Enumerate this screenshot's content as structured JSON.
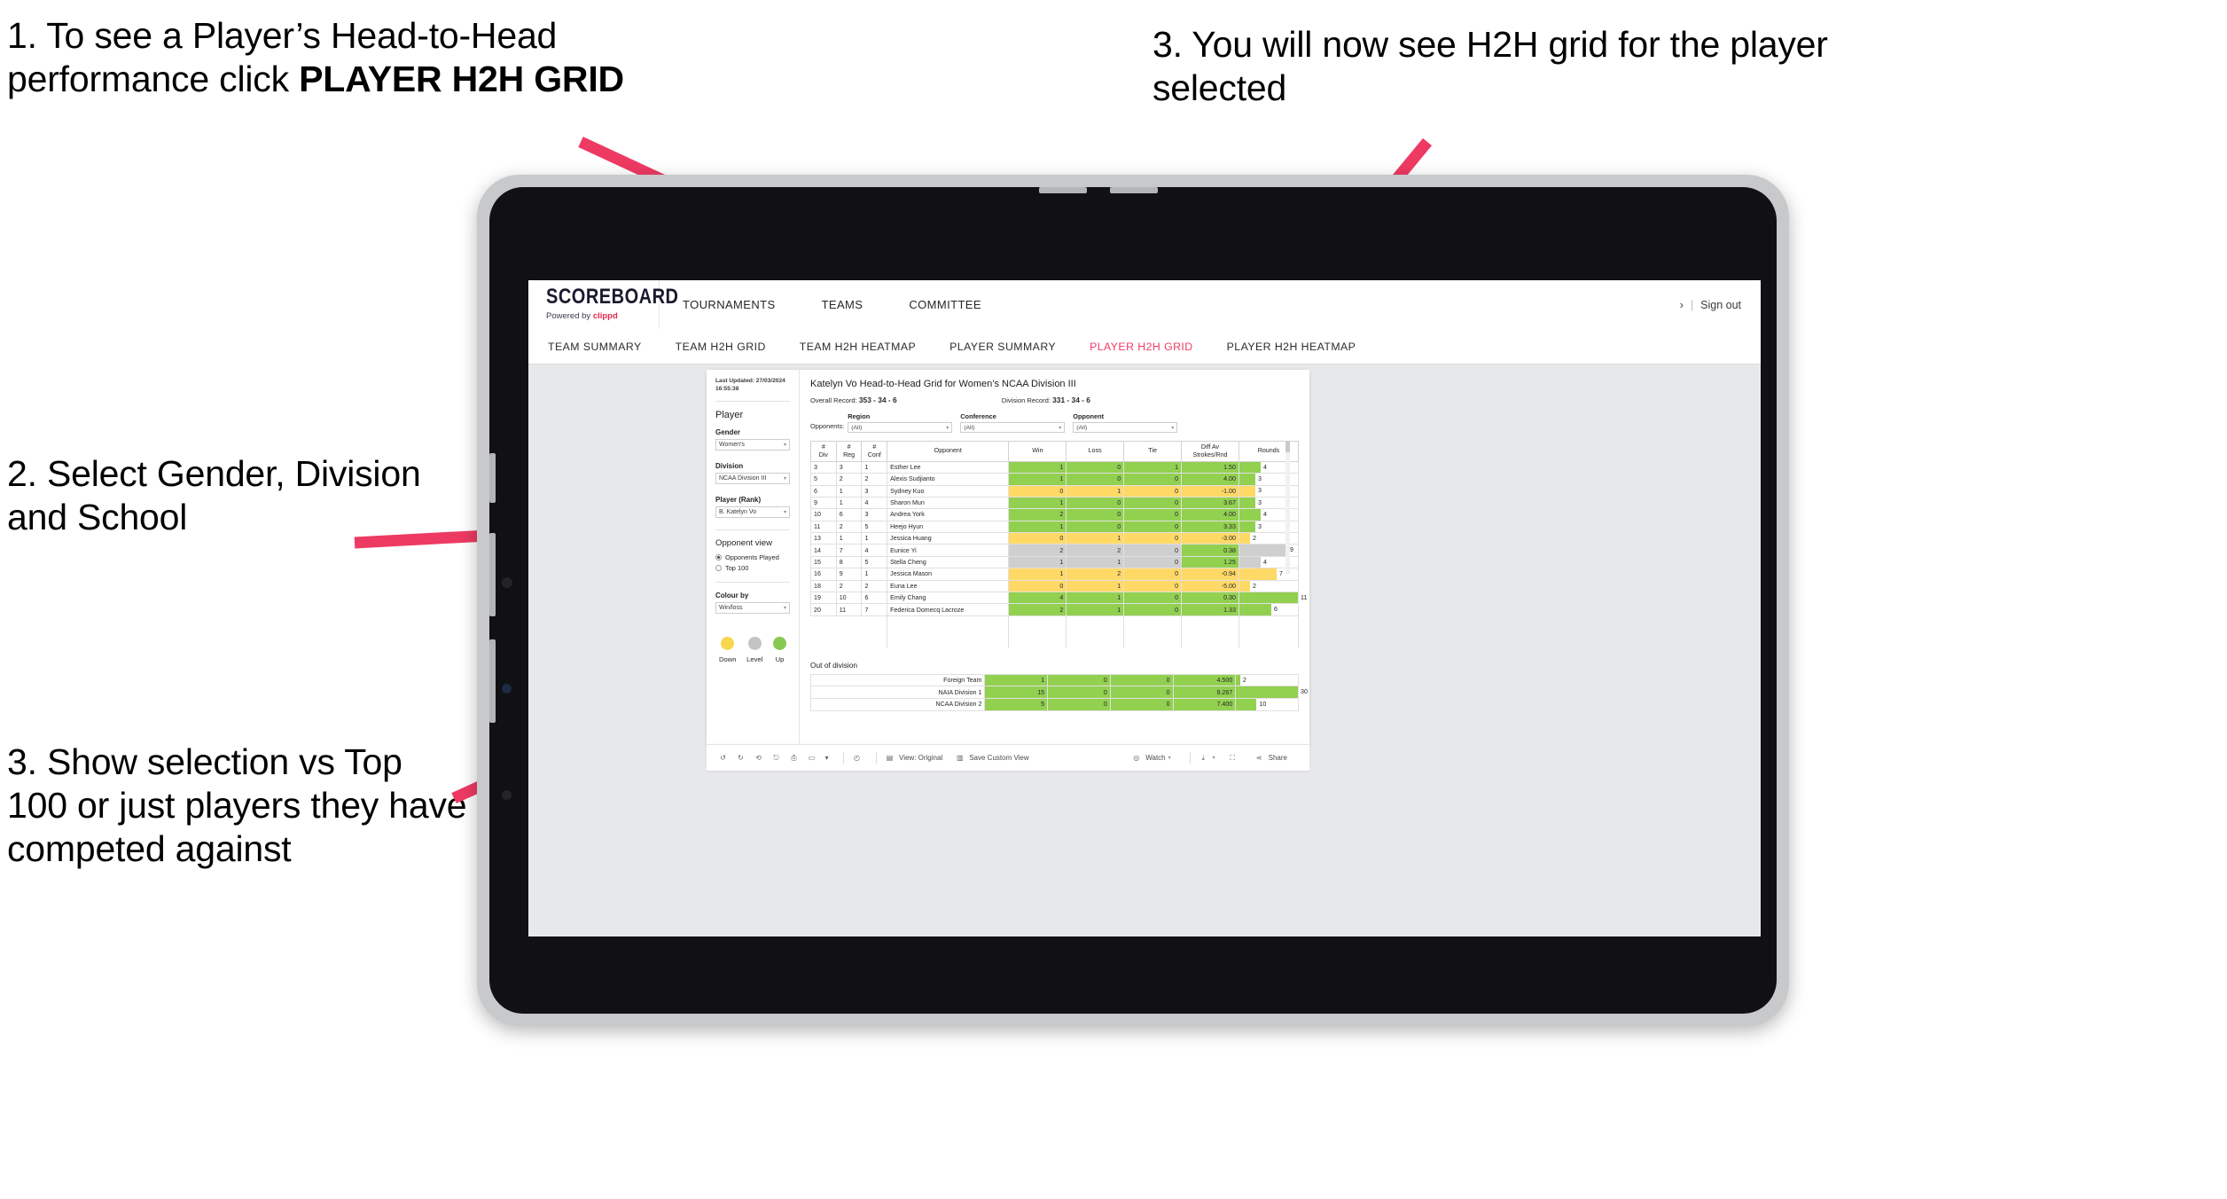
{
  "annotations": [
    {
      "id": "a1",
      "text_plain": "1. To see a Player’s Head-to-Head performance click ",
      "text_bold": "PLAYER H2H GRID"
    },
    {
      "id": "a2",
      "text": "2. Select Gender, Division and School"
    },
    {
      "id": "a3",
      "text": "3. Show selection vs Top 100 or just players they have competed against"
    },
    {
      "id": "a4",
      "text": "3. You will now see H2H grid for the player selected"
    }
  ],
  "arrow_color": "#ee3a63",
  "app": {
    "logo": {
      "main": "SCOREBOARD",
      "powered": "Powered by ",
      "brand": "clippd"
    },
    "nav": [
      {
        "label": "TOURNAMENTS"
      },
      {
        "label": "TEAMS"
      },
      {
        "label": "COMMITTEE"
      }
    ],
    "signout": {
      "chevron": "›",
      "separator": "|",
      "label": "Sign out"
    },
    "tabs": [
      {
        "label": "TEAM SUMMARY",
        "active": false
      },
      {
        "label": "TEAM H2H GRID",
        "active": false
      },
      {
        "label": "TEAM H2H HEATMAP",
        "active": false
      },
      {
        "label": "PLAYER SUMMARY",
        "active": false
      },
      {
        "label": "PLAYER H2H GRID",
        "active": true
      },
      {
        "label": "PLAYER H2H HEATMAP",
        "active": false
      }
    ]
  },
  "sidebar": {
    "last_updated": "Last Updated: 27/03/2024 16:55:38",
    "player_heading": "Player",
    "gender": {
      "label": "Gender",
      "value": "Women's"
    },
    "division": {
      "label": "Division",
      "value": "NCAA Division III"
    },
    "player_rank": {
      "label": "Player (Rank)",
      "value": "B. Katelyn Vo"
    },
    "opponent_view": {
      "heading": "Opponent view",
      "options": [
        {
          "label": "Opponents Played",
          "selected": true
        },
        {
          "label": "Top 100",
          "selected": false
        }
      ]
    },
    "colour_by": {
      "label": "Colour by",
      "value": "Win/loss"
    },
    "legend": [
      {
        "label": "Down",
        "color": "#f6d74e"
      },
      {
        "label": "Level",
        "color": "#c4c4c6"
      },
      {
        "label": "Up",
        "color": "#86c951"
      }
    ]
  },
  "main": {
    "title": "Katelyn Vo Head-to-Head Grid for Women’s NCAA Division III",
    "overall_record": {
      "label": "Overall Record: ",
      "value": "353 -  34 - 6"
    },
    "division_record": {
      "label": "Division Record: ",
      "value": "331 -  34 - 6"
    },
    "opponents_label": "Opponents:",
    "filters": [
      {
        "label": "Region",
        "value": "(All)"
      },
      {
        "label": "Conference",
        "value": "(All)"
      },
      {
        "label": "Opponent",
        "value": "(All)"
      }
    ],
    "out_of_division_title": "Out of division"
  },
  "chart_data": {
    "type": "table",
    "title": "Katelyn Vo Head-to-Head Grid for Women’s NCAA Division III",
    "columns": [
      "# Div",
      "# Reg",
      "# Conf",
      "Opponent",
      "Win",
      "Loss",
      "Tie",
      "Diff Av Strokes/Rnd",
      "Rounds"
    ],
    "column_headers_two_line": [
      {
        "l1": "#",
        "l2": "Div"
      },
      {
        "l1": "#",
        "l2": "Reg"
      },
      {
        "l1": "#",
        "l2": "Conf"
      },
      {
        "l1": "Opponent",
        "l2": ""
      },
      {
        "l1": "Win",
        "l2": ""
      },
      {
        "l1": "Loss",
        "l2": ""
      },
      {
        "l1": "Tie",
        "l2": ""
      },
      {
        "l1": "Diff Av",
        "l2": "Strokes/Rnd"
      },
      {
        "l1": "Rounds",
        "l2": ""
      }
    ],
    "rounds_max": 11,
    "rows": [
      {
        "div": "3",
        "reg": "3",
        "conf": "1",
        "opponent": "Esther Lee",
        "win": "1",
        "loss": "0",
        "tie": "1",
        "diff": "1.50",
        "rounds": "4",
        "state": "up"
      },
      {
        "div": "5",
        "reg": "2",
        "conf": "2",
        "opponent": "Alexis Sudjianto",
        "win": "1",
        "loss": "0",
        "tie": "0",
        "diff": "4.00",
        "rounds": "3",
        "state": "up"
      },
      {
        "div": "6",
        "reg": "1",
        "conf": "3",
        "opponent": "Sydney Kuo",
        "win": "0",
        "loss": "1",
        "tie": "0",
        "diff": "-1.00",
        "rounds": "3",
        "state": "down"
      },
      {
        "div": "9",
        "reg": "1",
        "conf": "4",
        "opponent": "Sharon Mun",
        "win": "1",
        "loss": "0",
        "tie": "0",
        "diff": "3.67",
        "rounds": "3",
        "state": "up"
      },
      {
        "div": "10",
        "reg": "6",
        "conf": "3",
        "opponent": "Andrea York",
        "win": "2",
        "loss": "0",
        "tie": "0",
        "diff": "4.00",
        "rounds": "4",
        "state": "up"
      },
      {
        "div": "11",
        "reg": "2",
        "conf": "5",
        "opponent": "Heejo Hyun",
        "win": "1",
        "loss": "0",
        "tie": "0",
        "diff": "3.33",
        "rounds": "3",
        "state": "up"
      },
      {
        "div": "13",
        "reg": "1",
        "conf": "1",
        "opponent": "Jessica Huang",
        "win": "0",
        "loss": "1",
        "tie": "0",
        "diff": "-3.00",
        "rounds": "2",
        "state": "down"
      },
      {
        "div": "14",
        "reg": "7",
        "conf": "4",
        "opponent": "Eunice Yi",
        "win": "2",
        "loss": "2",
        "tie": "0",
        "diff": "0.38",
        "rounds": "9",
        "state": "level",
        "diff_state": "up"
      },
      {
        "div": "15",
        "reg": "8",
        "conf": "5",
        "opponent": "Stella Cheng",
        "win": "1",
        "loss": "1",
        "tie": "0",
        "diff": "1.25",
        "rounds": "4",
        "state": "level",
        "diff_state": "up"
      },
      {
        "div": "16",
        "reg": "9",
        "conf": "1",
        "opponent": "Jessica Mason",
        "win": "1",
        "loss": "2",
        "tie": "0",
        "diff": "-0.94",
        "rounds": "7",
        "state": "down"
      },
      {
        "div": "18",
        "reg": "2",
        "conf": "2",
        "opponent": "Euna Lee",
        "win": "0",
        "loss": "1",
        "tie": "0",
        "diff": "-5.00",
        "rounds": "2",
        "state": "down"
      },
      {
        "div": "19",
        "reg": "10",
        "conf": "6",
        "opponent": "Emily Chang",
        "win": "4",
        "loss": "1",
        "tie": "0",
        "diff": "0.30",
        "rounds": "11",
        "state": "up"
      },
      {
        "div": "20",
        "reg": "11",
        "conf": "7",
        "opponent": "Federica Domecq Lacroze",
        "win": "2",
        "loss": "1",
        "tie": "0",
        "diff": "1.33",
        "rounds": "6",
        "state": "up"
      }
    ],
    "out_of_division": {
      "title": "Out of division",
      "rounds_max": 30,
      "rows": [
        {
          "name": "Foreign Team",
          "win": "1",
          "loss": "0",
          "tie": "0",
          "diff": "4.500",
          "rounds": "2",
          "state": "up"
        },
        {
          "name": "NAIA Division 1",
          "win": "15",
          "loss": "0",
          "tie": "0",
          "diff": "9.267",
          "rounds": "30",
          "state": "up"
        },
        {
          "name": "NCAA Division 2",
          "win": "5",
          "loss": "0",
          "tie": "0",
          "diff": "7.400",
          "rounds": "10",
          "state": "up"
        }
      ]
    }
  },
  "toolbar": {
    "view_label": "View: Original",
    "save_label": "Save Custom View",
    "watch_label": "Watch",
    "share_label": "Share"
  }
}
